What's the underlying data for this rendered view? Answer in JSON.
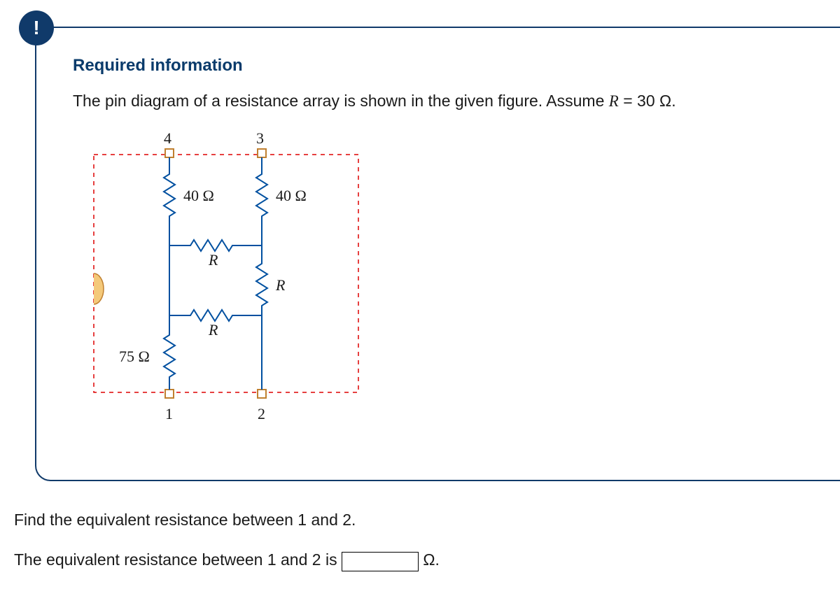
{
  "badge": "!",
  "heading": "Required information",
  "prompt_prefix": "The pin diagram of a resistance array is shown in the given figure. Assume ",
  "prompt_var": "R",
  "prompt_eq": " = 30 Ω.",
  "figure": {
    "pins": {
      "p1": "1",
      "p2": "2",
      "p3": "3",
      "p4": "4"
    },
    "labels": {
      "r40a": "40 Ω",
      "r40b": "40 Ω",
      "ra": "R",
      "rb": "R",
      "rc": "R",
      "r75": "75 Ω"
    }
  },
  "question": "Find the equivalent resistance between 1 and 2.",
  "answer_prefix": "The equivalent resistance between 1 and 2 is ",
  "answer_unit": "Ω.",
  "answer_value": ""
}
